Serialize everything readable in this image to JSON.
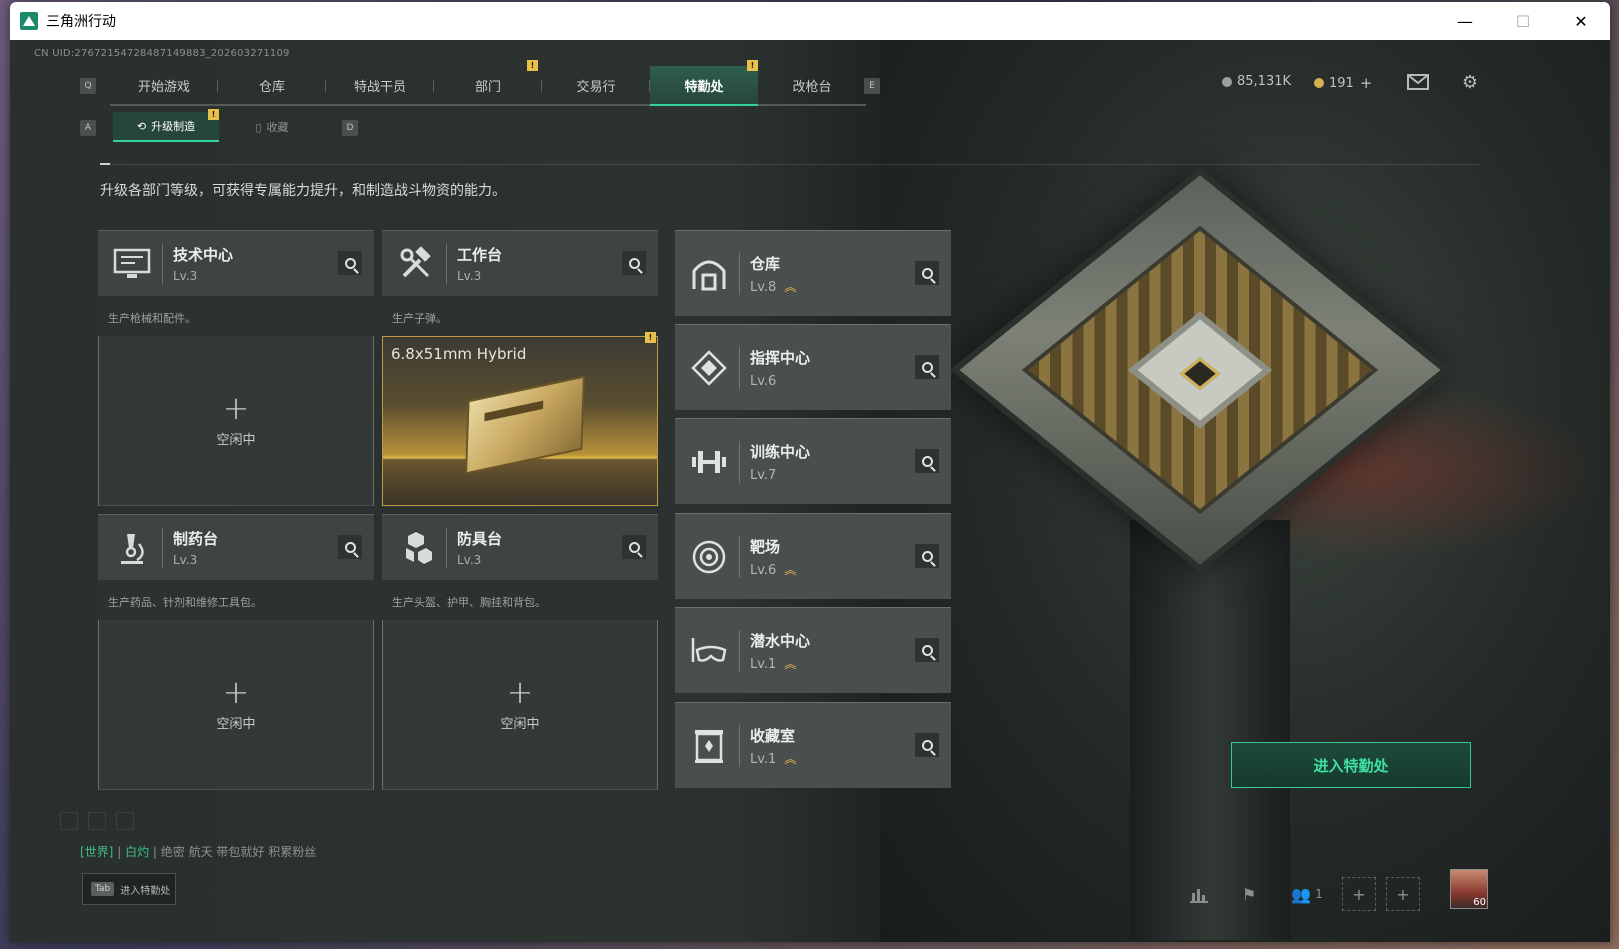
{
  "window": {
    "title": "三角洲行动",
    "controls": [
      "—",
      "☐",
      "✕"
    ]
  },
  "uid": "CN UID:2767215472848714988​3_202603271109",
  "topnav": {
    "left_key": "Q",
    "right_key": "E",
    "tabs": [
      {
        "label": "开始游戏"
      },
      {
        "label": "仓库"
      },
      {
        "label": "特战干员"
      },
      {
        "label": "部门",
        "badge": "!"
      },
      {
        "label": "交易行"
      },
      {
        "label": "特勤处",
        "badge": "!"
      },
      {
        "label": "改枪台"
      }
    ]
  },
  "currency": {
    "money": "85,131K",
    "coins": "191",
    "add": "+"
  },
  "subnav": {
    "left_key": "A",
    "right_key": "D",
    "tabs": [
      {
        "label": "升级制造",
        "badge": "!"
      },
      {
        "label": "收藏"
      }
    ]
  },
  "description": "升级各部门等级，可获得专属能力提升，和制造战斗物资的能力。",
  "workstations": [
    {
      "name": "技术中心",
      "level": "Lv.3",
      "sub": "生产枪械和配件。",
      "status": "空闲中",
      "plus": "+"
    },
    {
      "name": "工作台",
      "level": "Lv.3",
      "sub": "生产子弹。",
      "item": "6.8x51mm Hybrid",
      "badge": "!"
    },
    {
      "name": "制药台",
      "level": "Lv.3",
      "sub": "生产药品、针剂和维修工具包。",
      "status": "空闲中",
      "plus": "+"
    },
    {
      "name": "防具台",
      "level": "Lv.3",
      "sub": "生产头盔、护甲、胸挂和背包。",
      "status": "空闲中",
      "plus": "+"
    }
  ],
  "facilities": [
    {
      "name": "仓库",
      "level": "Lv.8",
      "upgradable": true
    },
    {
      "name": "指挥中心",
      "level": "Lv.6",
      "upgradable": false
    },
    {
      "name": "训练中心",
      "level": "Lv.7",
      "upgradable": false
    },
    {
      "name": "靶场",
      "level": "Lv.6",
      "upgradable": true
    },
    {
      "name": "潜水中心",
      "level": "Lv.1",
      "upgradable": true
    },
    {
      "name": "收藏室",
      "level": "Lv.1",
      "upgradable": true
    }
  ],
  "enter_button": "进入特勤处",
  "chat": {
    "channel_world": "[世界]",
    "channel_sep": "|",
    "channel_2": "白灼",
    "message": "绝密 航天 带包就好 积累粉丝"
  },
  "tab_hint": {
    "key": "Tab",
    "label": "进入特勤处"
  },
  "bottom": {
    "friends_count": "1",
    "avatar_level": "60"
  },
  "colors": {
    "accent": "#33d19a",
    "gold": "#e8b84a",
    "panel": "#3f4442"
  }
}
